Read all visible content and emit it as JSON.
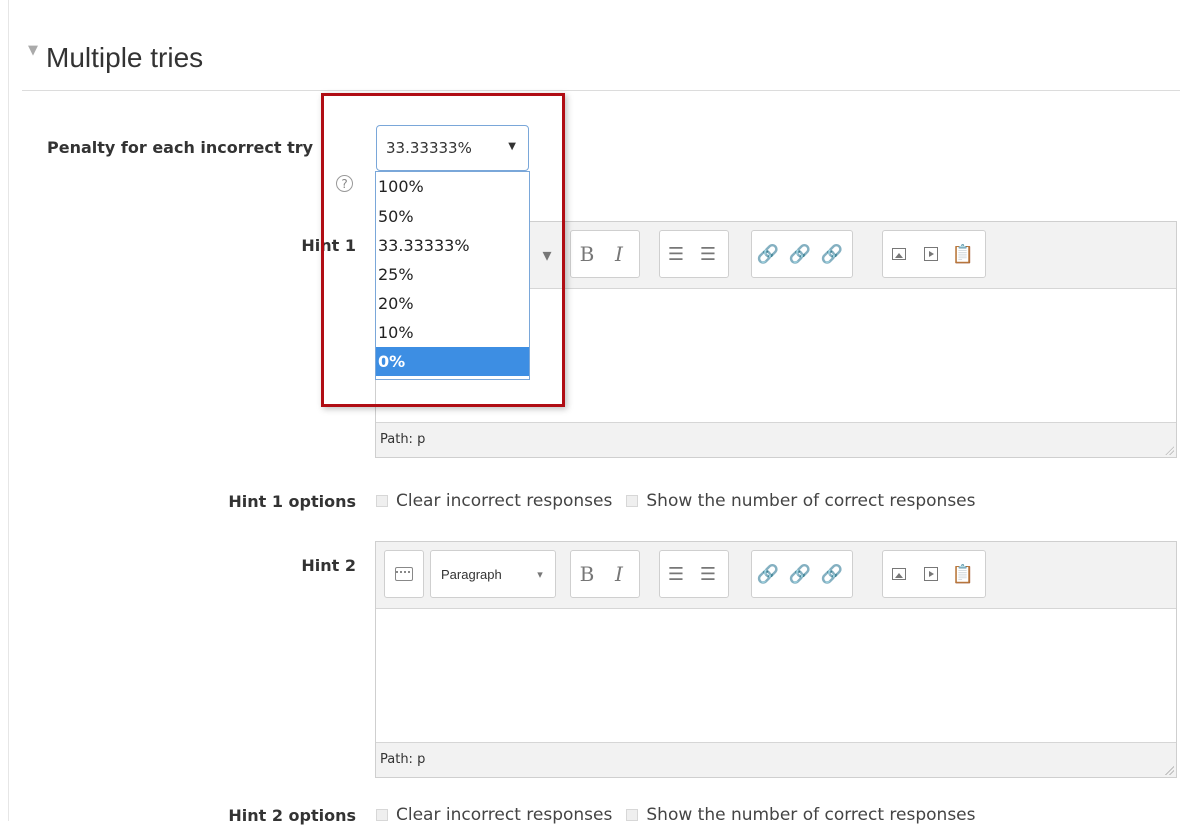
{
  "section": {
    "title": "Multiple tries",
    "collapse_icon": "triangle-down-icon"
  },
  "penalty": {
    "label": "Penalty for each incorrect try",
    "selected": "33.33333%",
    "help_icon": "question-circle-icon",
    "options": [
      "100%",
      "50%",
      "33.33333%",
      "25%",
      "20%",
      "10%",
      "0%"
    ],
    "highlighted": "0%"
  },
  "hint1": {
    "label": "Hint 1",
    "path": "Path: p",
    "options_label": "Hint 1 options",
    "clear_incorrect": "Clear incorrect responses",
    "show_number": "Show the number of correct responses"
  },
  "hint2": {
    "label": "Hint 2",
    "format": "Paragraph",
    "path": "Path: p",
    "options_label": "Hint 2 options",
    "clear_incorrect": "Clear incorrect responses",
    "show_number": "Show the number of correct responses"
  },
  "toolbar": {
    "bold": "B",
    "italic": "I"
  },
  "colors": {
    "highlight": "#3d8ee3",
    "annotation_box": "#b00d14",
    "select_border": "#7aa7d9"
  }
}
